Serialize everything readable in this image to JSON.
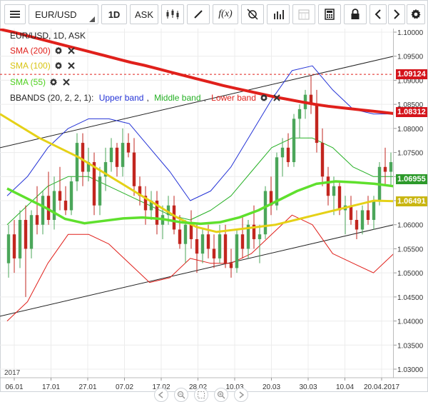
{
  "toolbar": {
    "symbol": "EUR/USD",
    "timeframe": "1D",
    "price_type": "ASK",
    "function_label": "f(x)",
    "icons": [
      "menu-icon",
      "candles-icon",
      "draw-icon",
      "function-icon",
      "crosshair-icon",
      "volume-icon",
      "calendar-icon",
      "calculator-icon",
      "lock-icon",
      "chevron-left-icon",
      "chevron-right-icon",
      "gear-icon"
    ]
  },
  "legend": {
    "instrument": "EUR/USD, 1D, ASK",
    "sma200": "SMA (200)",
    "sma100": "SMA (100)",
    "sma55": "SMA (55)",
    "bbands_prefix": "BBANDS (20, 2, 2, 1): ",
    "upper": "Upper band",
    "middle": "Middle band",
    "lower": "Lower band"
  },
  "colors": {
    "sma200": "#e0201b",
    "sma100": "#e5d117",
    "sma55": "#5fe02d",
    "upper": "#2433d6",
    "middle": "#26b025",
    "lower": "#e0201b",
    "up_candle": "#4ba65a",
    "down_candle": "#c2261f",
    "channel": "#222222",
    "dashed": "#e0201b"
  },
  "price_tags": [
    {
      "value": "1.09124",
      "color": "#d4141b"
    },
    {
      "value": "1.08312",
      "color": "#d4141b"
    },
    {
      "value": "1.06955",
      "color": "#2d9a2b"
    },
    {
      "value": "1.06491",
      "color": "#c9b612"
    }
  ],
  "y_axis_labels": [
    "1.10000",
    "1.09500",
    "1.09000",
    "1.08500",
    "1.08000",
    "1.07500",
    "1.07000",
    "1.06500",
    "1.06000",
    "1.05500",
    "1.05000",
    "1.04500",
    "1.04000",
    "1.03500",
    "1.03000"
  ],
  "x_axis_labels": [
    "06.01",
    "17.01",
    "27.01",
    "07.02",
    "17.02",
    "28.02",
    "10.03",
    "20.03",
    "30.03",
    "10.04",
    "20.04.2017"
  ],
  "year_label": "2017",
  "nav_controls": [
    "scroll-left-icon",
    "zoom-out-icon",
    "zoom-reset-icon",
    "zoom-in-icon",
    "scroll-right-icon"
  ],
  "chart_data": {
    "type": "candlestick",
    "instrument": "EUR/USD",
    "interval": "1D",
    "ylim": [
      1.03,
      1.1
    ],
    "x_labels": [
      "06.01",
      "17.01",
      "27.01",
      "07.02",
      "17.02",
      "28.02",
      "10.03",
      "20.03",
      "30.03",
      "10.04",
      "20.04.2017"
    ],
    "last_values": {
      "dashed_level": 1.09124,
      "sma200": 1.08312,
      "middle_band": 1.06955,
      "sma100": 1.06491
    },
    "candles": [
      {
        "o": 1.052,
        "h": 1.06,
        "l": 1.049,
        "c": 1.058
      },
      {
        "o": 1.058,
        "h": 1.061,
        "l": 1.05,
        "c": 1.053
      },
      {
        "o": 1.053,
        "h": 1.063,
        "l": 1.051,
        "c": 1.061
      },
      {
        "o": 1.061,
        "h": 1.064,
        "l": 1.045,
        "c": 1.055
      },
      {
        "o": 1.055,
        "h": 1.063,
        "l": 1.053,
        "c": 1.062
      },
      {
        "o": 1.062,
        "h": 1.068,
        "l": 1.058,
        "c": 1.06
      },
      {
        "o": 1.06,
        "h": 1.067,
        "l": 1.058,
        "c": 1.066
      },
      {
        "o": 1.066,
        "h": 1.071,
        "l": 1.06,
        "c": 1.061
      },
      {
        "o": 1.061,
        "h": 1.07,
        "l": 1.059,
        "c": 1.067
      },
      {
        "o": 1.067,
        "h": 1.072,
        "l": 1.063,
        "c": 1.065
      },
      {
        "o": 1.065,
        "h": 1.068,
        "l": 1.062,
        "c": 1.063
      },
      {
        "o": 1.063,
        "h": 1.07,
        "l": 1.062,
        "c": 1.069
      },
      {
        "o": 1.069,
        "h": 1.079,
        "l": 1.067,
        "c": 1.077
      },
      {
        "o": 1.077,
        "h": 1.079,
        "l": 1.068,
        "c": 1.071
      },
      {
        "o": 1.071,
        "h": 1.076,
        "l": 1.069,
        "c": 1.073
      },
      {
        "o": 1.073,
        "h": 1.075,
        "l": 1.062,
        "c": 1.064
      },
      {
        "o": 1.064,
        "h": 1.072,
        "l": 1.062,
        "c": 1.07
      },
      {
        "o": 1.07,
        "h": 1.076,
        "l": 1.067,
        "c": 1.073
      },
      {
        "o": 1.073,
        "h": 1.078,
        "l": 1.071,
        "c": 1.076
      },
      {
        "o": 1.076,
        "h": 1.077,
        "l": 1.07,
        "c": 1.072
      },
      {
        "o": 1.072,
        "h": 1.08,
        "l": 1.07,
        "c": 1.077
      },
      {
        "o": 1.077,
        "h": 1.079,
        "l": 1.074,
        "c": 1.075
      },
      {
        "o": 1.075,
        "h": 1.078,
        "l": 1.066,
        "c": 1.068
      },
      {
        "o": 1.068,
        "h": 1.07,
        "l": 1.064,
        "c": 1.066
      },
      {
        "o": 1.066,
        "h": 1.068,
        "l": 1.06,
        "c": 1.063
      },
      {
        "o": 1.063,
        "h": 1.067,
        "l": 1.061,
        "c": 1.065
      },
      {
        "o": 1.065,
        "h": 1.067,
        "l": 1.058,
        "c": 1.06
      },
      {
        "o": 1.06,
        "h": 1.064,
        "l": 1.057,
        "c": 1.062
      },
      {
        "o": 1.062,
        "h": 1.066,
        "l": 1.06,
        "c": 1.064
      },
      {
        "o": 1.064,
        "h": 1.066,
        "l": 1.058,
        "c": 1.059
      },
      {
        "o": 1.059,
        "h": 1.062,
        "l": 1.055,
        "c": 1.056
      },
      {
        "o": 1.056,
        "h": 1.061,
        "l": 1.052,
        "c": 1.06
      },
      {
        "o": 1.06,
        "h": 1.063,
        "l": 1.055,
        "c": 1.057
      },
      {
        "o": 1.057,
        "h": 1.06,
        "l": 1.05,
        "c": 1.054
      },
      {
        "o": 1.054,
        "h": 1.059,
        "l": 1.052,
        "c": 1.058
      },
      {
        "o": 1.058,
        "h": 1.06,
        "l": 1.053,
        "c": 1.055
      },
      {
        "o": 1.055,
        "h": 1.058,
        "l": 1.051,
        "c": 1.053
      },
      {
        "o": 1.053,
        "h": 1.06,
        "l": 1.052,
        "c": 1.058
      },
      {
        "o": 1.058,
        "h": 1.06,
        "l": 1.051,
        "c": 1.052
      },
      {
        "o": 1.052,
        "h": 1.055,
        "l": 1.049,
        "c": 1.051
      },
      {
        "o": 1.051,
        "h": 1.059,
        "l": 1.05,
        "c": 1.058
      },
      {
        "o": 1.058,
        "h": 1.062,
        "l": 1.053,
        "c": 1.055
      },
      {
        "o": 1.055,
        "h": 1.061,
        "l": 1.053,
        "c": 1.06
      },
      {
        "o": 1.06,
        "h": 1.064,
        "l": 1.055,
        "c": 1.057
      },
      {
        "o": 1.057,
        "h": 1.06,
        "l": 1.052,
        "c": 1.058
      },
      {
        "o": 1.058,
        "h": 1.068,
        "l": 1.057,
        "c": 1.067
      },
      {
        "o": 1.067,
        "h": 1.07,
        "l": 1.062,
        "c": 1.064
      },
      {
        "o": 1.064,
        "h": 1.075,
        "l": 1.063,
        "c": 1.074
      },
      {
        "o": 1.074,
        "h": 1.078,
        "l": 1.07,
        "c": 1.076
      },
      {
        "o": 1.076,
        "h": 1.079,
        "l": 1.072,
        "c": 1.073
      },
      {
        "o": 1.073,
        "h": 1.083,
        "l": 1.072,
        "c": 1.082
      },
      {
        "o": 1.082,
        "h": 1.085,
        "l": 1.078,
        "c": 1.084
      },
      {
        "o": 1.084,
        "h": 1.088,
        "l": 1.082,
        "c": 1.087
      },
      {
        "o": 1.087,
        "h": 1.091,
        "l": 1.083,
        "c": 1.085
      },
      {
        "o": 1.085,
        "h": 1.088,
        "l": 1.075,
        "c": 1.077
      },
      {
        "o": 1.077,
        "h": 1.08,
        "l": 1.068,
        "c": 1.07
      },
      {
        "o": 1.07,
        "h": 1.072,
        "l": 1.064,
        "c": 1.066
      },
      {
        "o": 1.066,
        "h": 1.07,
        "l": 1.062,
        "c": 1.068
      },
      {
        "o": 1.068,
        "h": 1.069,
        "l": 1.062,
        "c": 1.063
      },
      {
        "o": 1.063,
        "h": 1.066,
        "l": 1.058,
        "c": 1.064
      },
      {
        "o": 1.064,
        "h": 1.066,
        "l": 1.06,
        "c": 1.061
      },
      {
        "o": 1.061,
        "h": 1.063,
        "l": 1.057,
        "c": 1.059
      },
      {
        "o": 1.059,
        "h": 1.064,
        "l": 1.058,
        "c": 1.063
      },
      {
        "o": 1.063,
        "h": 1.066,
        "l": 1.06,
        "c": 1.061
      },
      {
        "o": 1.061,
        "h": 1.066,
        "l": 1.059,
        "c": 1.065
      },
      {
        "o": 1.065,
        "h": 1.073,
        "l": 1.064,
        "c": 1.072
      },
      {
        "o": 1.072,
        "h": 1.076,
        "l": 1.068,
        "c": 1.071
      },
      {
        "o": 1.071,
        "h": 1.075,
        "l": 1.068,
        "c": 1.073
      }
    ],
    "series": [
      {
        "name": "SMA (200)",
        "role": "sma200",
        "values": [
          1.1006,
          1.1,
          1.0993,
          1.0986,
          1.0979,
          1.0972,
          1.0965,
          1.0958,
          1.0951,
          1.0944,
          1.0937,
          1.0931,
          1.0924,
          1.0917,
          1.091,
          1.0903,
          1.0896,
          1.0889,
          1.0883,
          1.0877,
          1.0871,
          1.0865,
          1.086,
          1.0855,
          1.085,
          1.0846,
          1.0843,
          1.084,
          1.0837,
          1.0834,
          1.0831
        ]
      },
      {
        "name": "SMA (100)",
        "role": "sma100",
        "values": [
          1.083,
          1.0805,
          1.078,
          1.076,
          1.074,
          1.0715,
          1.069,
          1.0665,
          1.064,
          1.0615,
          1.0595,
          1.0585,
          1.059,
          1.0595,
          1.06,
          1.061,
          1.062,
          1.063,
          1.064,
          1.065,
          1.0649
        ]
      },
      {
        "name": "SMA (55)",
        "role": "sma55",
        "values": [
          1.0675,
          1.0655,
          1.0635,
          1.0612,
          1.0603,
          1.0608,
          1.0613,
          1.0615,
          1.0612,
          1.0605,
          1.0602,
          1.0605,
          1.0615,
          1.063,
          1.065,
          1.067,
          1.0685,
          1.069,
          1.0688,
          1.0685,
          1.068
        ]
      },
      {
        "name": "Upper band",
        "role": "upper",
        "values": [
          1.066,
          1.07,
          1.076,
          1.08,
          1.082,
          1.082,
          1.081,
          1.076,
          1.071,
          1.065,
          1.067,
          1.072,
          1.079,
          1.086,
          1.092,
          1.093,
          1.088,
          1.084,
          1.083,
          1.083
        ]
      },
      {
        "name": "Middle band",
        "role": "middle",
        "values": [
          1.06,
          1.064,
          1.068,
          1.07,
          1.07,
          1.068,
          1.066,
          1.064,
          1.062,
          1.061,
          1.063,
          1.066,
          1.071,
          1.076,
          1.078,
          1.078,
          1.076,
          1.072,
          1.07,
          1.07
        ]
      },
      {
        "name": "Lower band",
        "role": "lower",
        "values": [
          1.04,
          1.044,
          1.052,
          1.058,
          1.058,
          1.056,
          1.052,
          1.048,
          1.049,
          1.053,
          1.052,
          1.052,
          1.054,
          1.058,
          1.062,
          1.06,
          1.054,
          1.052,
          1.05,
          1.054
        ]
      }
    ],
    "channel_lines": [
      {
        "name": "upper-channel",
        "from": {
          "x": 0,
          "y": 1.076
        },
        "to": {
          "x": 1,
          "y": 1.095
        }
      },
      {
        "name": "lower-channel",
        "from": {
          "x": 0,
          "y": 1.041
        },
        "to": {
          "x": 1,
          "y": 1.06
        }
      }
    ]
  }
}
